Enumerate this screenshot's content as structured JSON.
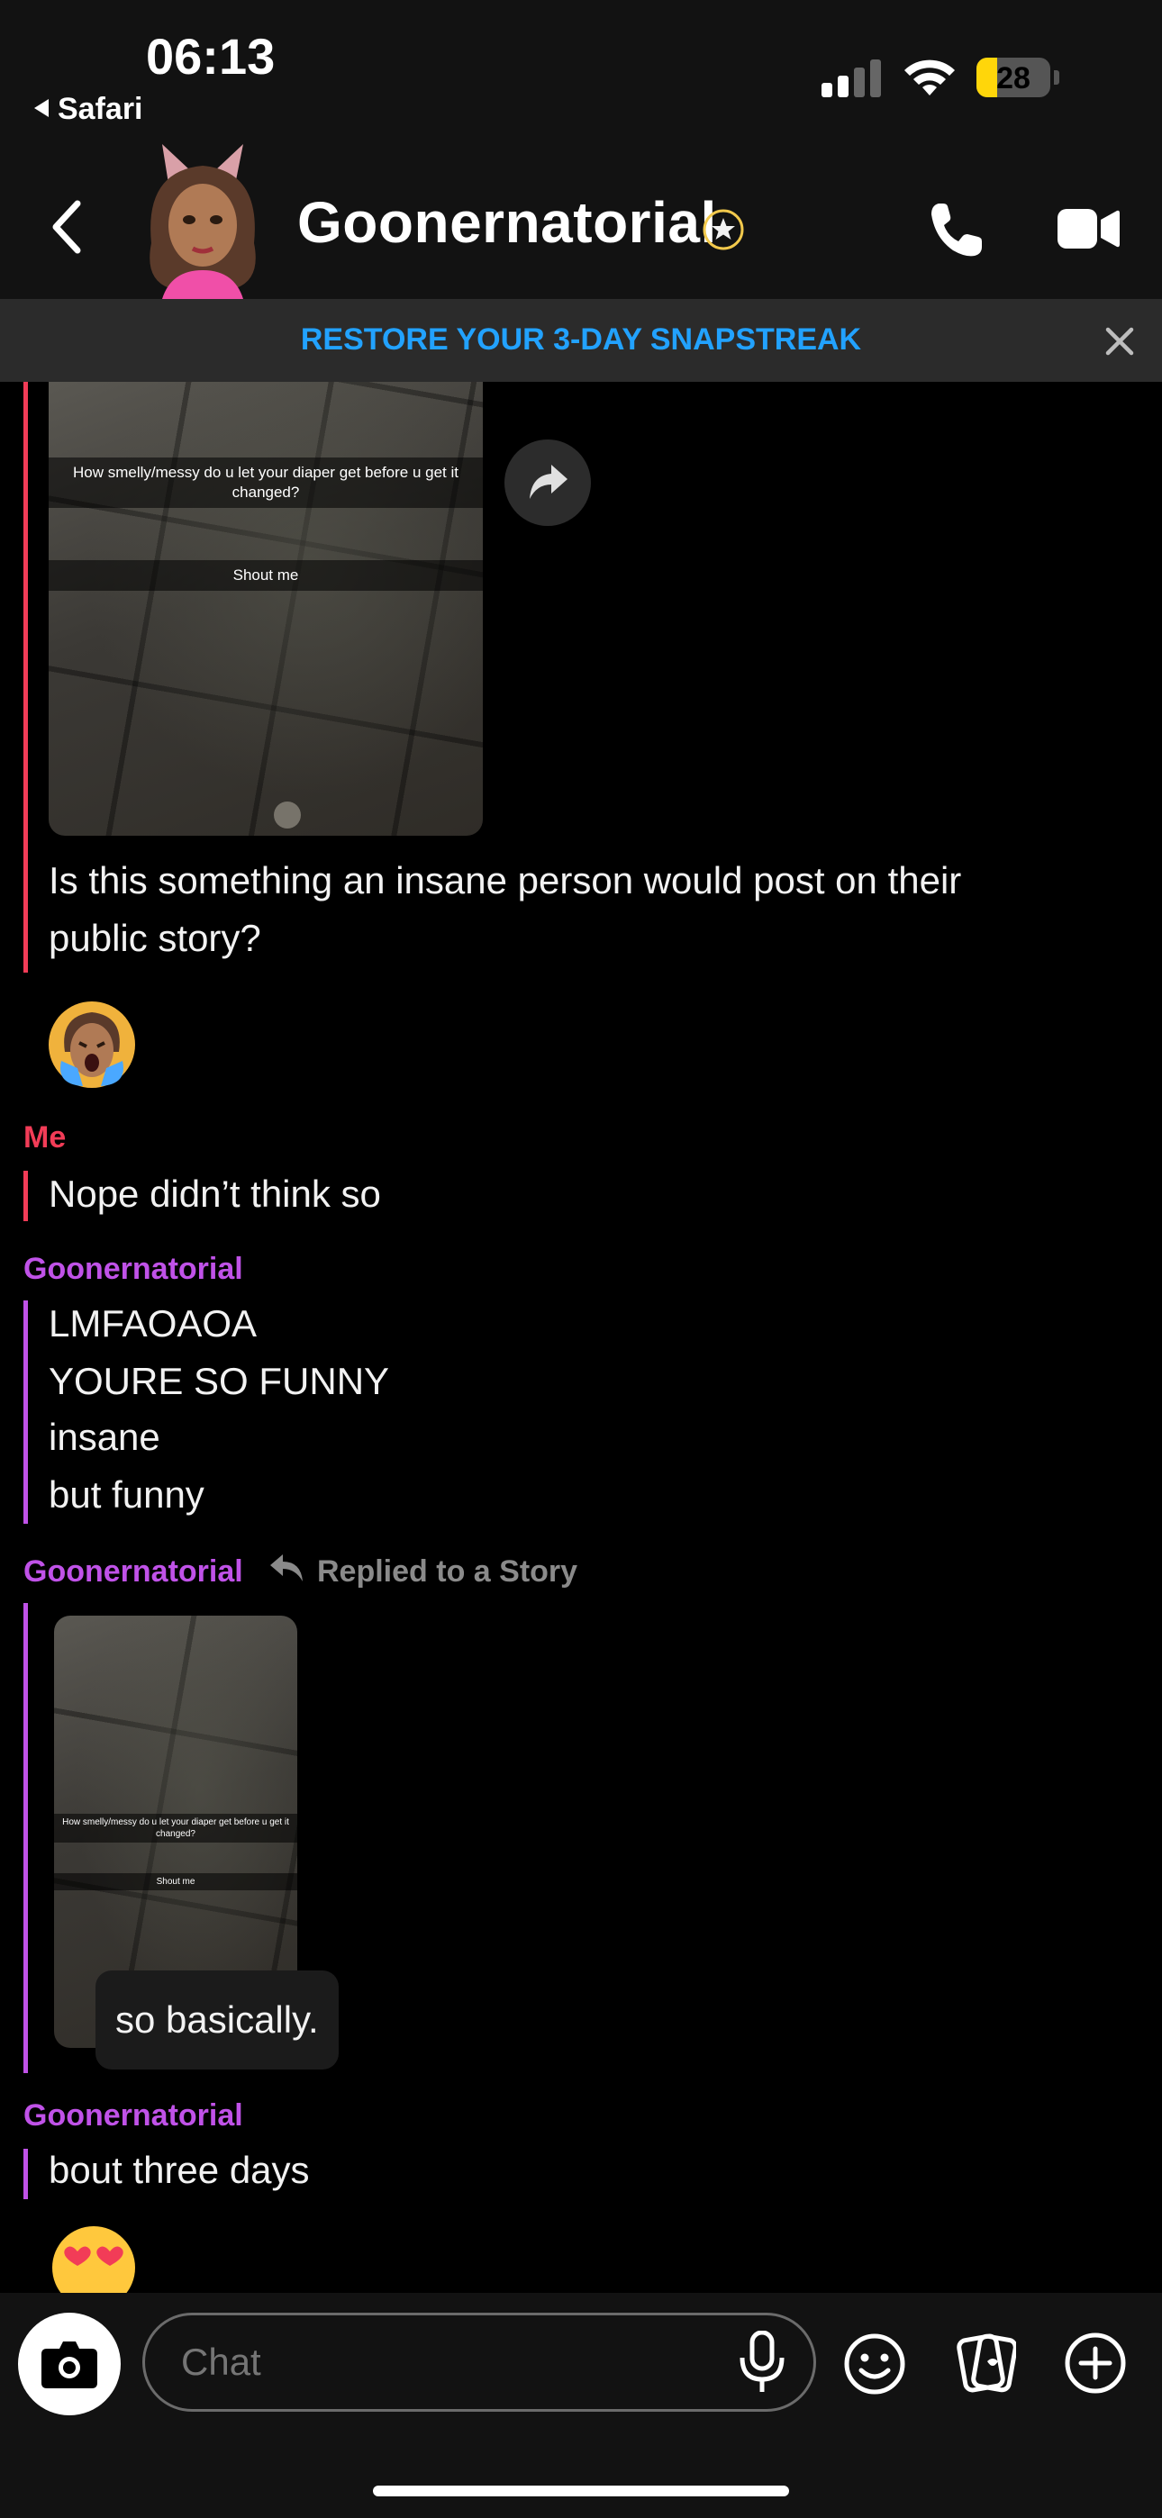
{
  "status_bar": {
    "time": "06:13",
    "back_app": "Safari",
    "battery": "28",
    "battery_level": 0.28
  },
  "header": {
    "title": "Goonernatorial"
  },
  "banner": {
    "text": "RESTORE YOUR 3-DAY SNAPSTREAK"
  },
  "thread": {
    "snap1": {
      "caption": "How smelly/messy do u let your diaper get before u get it changed?",
      "button": "Shout me"
    },
    "question": [
      "Is this something an insane person would post on their",
      "public story?"
    ],
    "me_name": "Me",
    "me_msg": "Nope didn’t think so",
    "friend_name": "Goonernatorial",
    "friend_msgs": [
      "LMFAOAOA",
      "YOURE SO FUNNY",
      "insane",
      "but funny"
    ],
    "reply_name": "Goonernatorial",
    "reply_label": "Replied to a Story",
    "snap2": {
      "caption": "How smelly/messy do u let your diaper get before u get it changed?",
      "button": "Shout me"
    },
    "reply_text": "so basically.",
    "last_name": "Goonernatorial",
    "last_msg": "bout three days"
  },
  "chat": {
    "placeholder": "Chat"
  },
  "colors": {
    "me": "#F23C57",
    "friend": "#C052E8",
    "banner_text": "#22A2FF",
    "battery": "#FFD60A"
  },
  "icons": [
    "back-chevron-icon",
    "avatar",
    "verified-star-icon",
    "phone-icon",
    "video-icon",
    "close-icon",
    "share-arrow-icon",
    "reply-arrow-icon",
    "camera-icon",
    "microphone-icon",
    "smiley-icon",
    "stickers-icon",
    "plus-icon"
  ]
}
